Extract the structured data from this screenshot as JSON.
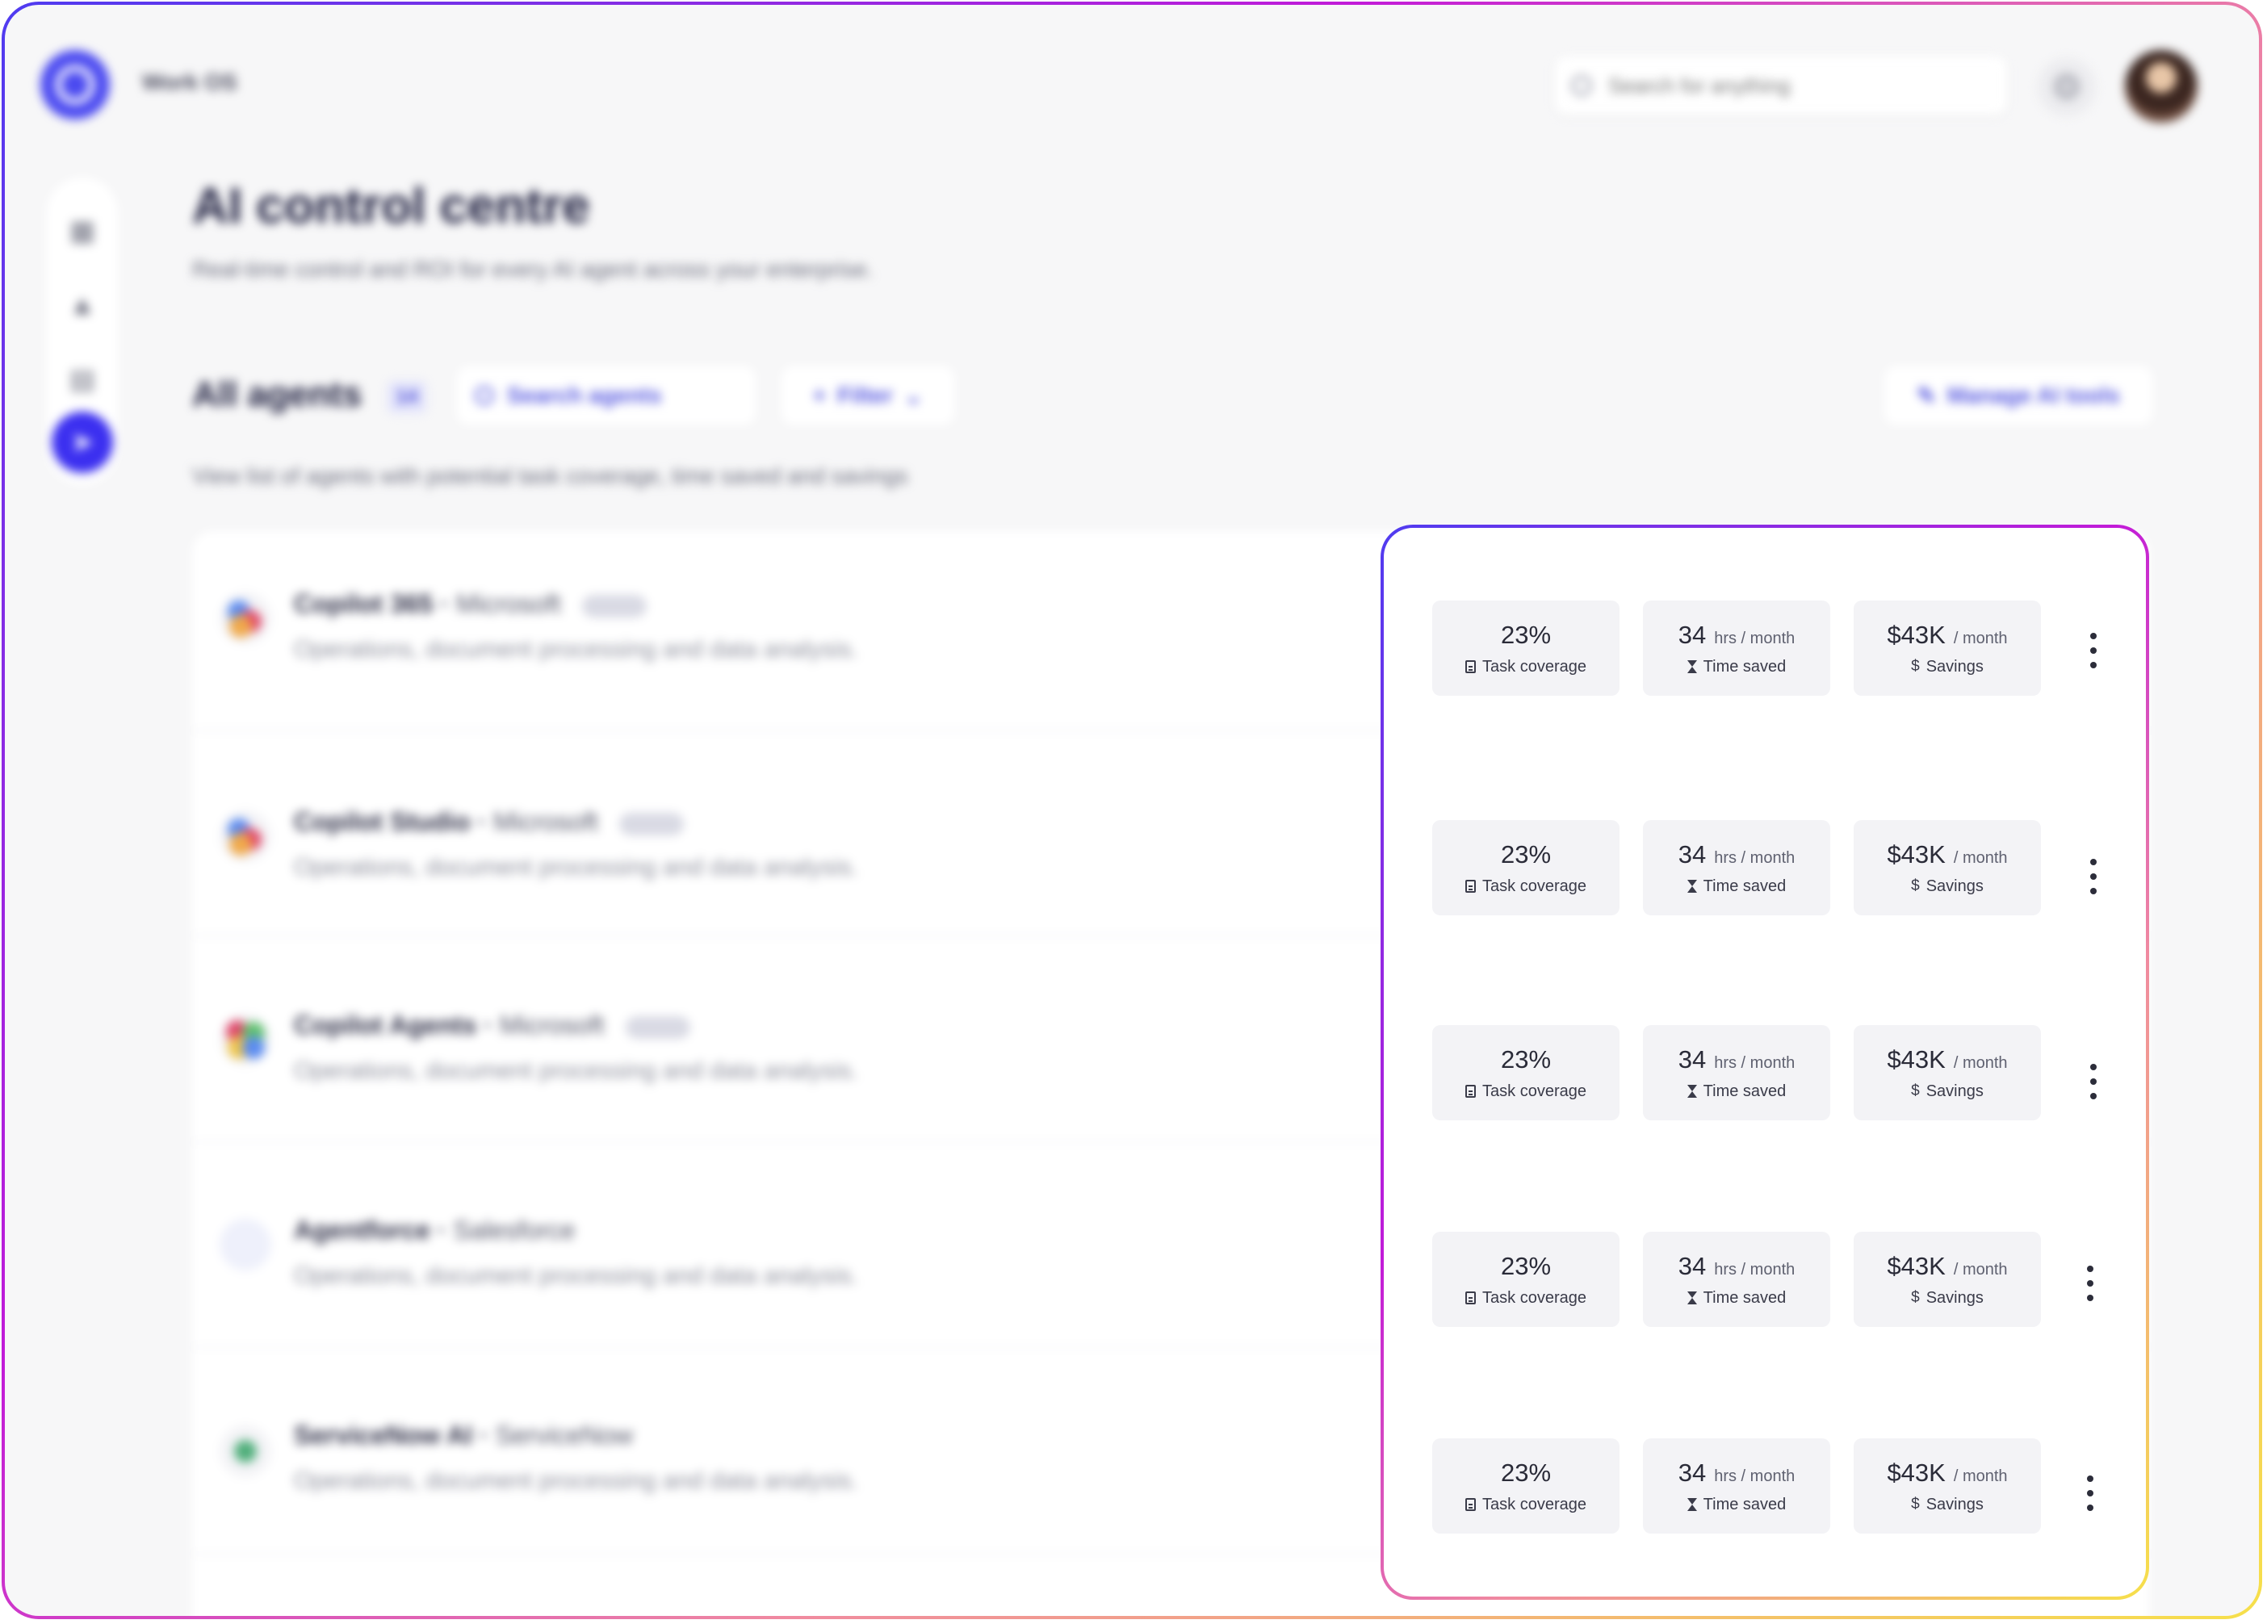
{
  "app": {
    "name": "Work OS"
  },
  "search": {
    "placeholder": "Search for anything"
  },
  "page": {
    "title": "AI control centre",
    "subtitle": "Real-time control and ROI for every AI agent across your enterprise."
  },
  "section": {
    "title": "All agents",
    "count": "14",
    "search_label": "Search agents",
    "filter_label": "Filter",
    "manage_label": "Manage AI tools",
    "subtitle": "View list of agents with potential task coverage, time saved and savings"
  },
  "agents": [
    {
      "name": "Copilot 365",
      "vendor": "Microsoft",
      "description": "Operations, document processing and data analysis.",
      "coverage": {
        "value": "23%",
        "label": "Task coverage"
      },
      "time": {
        "value": "34",
        "unit": "hrs / month",
        "label": "Time saved"
      },
      "savings": {
        "value": "$43K",
        "unit": "/ month",
        "label": "Savings",
        "glyph": "$"
      }
    },
    {
      "name": "Copilot Studio",
      "vendor": "Microsoft",
      "description": "Operations, document processing and data analysis.",
      "coverage": {
        "value": "23%",
        "label": "Task coverage"
      },
      "time": {
        "value": "34",
        "unit": "hrs / month",
        "label": "Time saved"
      },
      "savings": {
        "value": "$43K",
        "unit": "/ month",
        "label": "Savings",
        "glyph": "$"
      }
    },
    {
      "name": "Copilot Agents",
      "vendor": "Microsoft",
      "description": "Operations, document processing and data analysis.",
      "coverage": {
        "value": "23%",
        "label": "Task coverage"
      },
      "time": {
        "value": "34",
        "unit": "hrs / month",
        "label": "Time saved"
      },
      "savings": {
        "value": "$43K",
        "unit": "/ month",
        "label": "Savings",
        "glyph": "$"
      }
    },
    {
      "name": "Agentforce",
      "vendor": "Salesforce",
      "description": "Operations, document processing and data analysis.",
      "coverage": {
        "value": "23%",
        "label": "Task coverage"
      },
      "time": {
        "value": "34",
        "unit": "hrs / month",
        "label": "Time saved"
      },
      "savings": {
        "value": "$43K",
        "unit": "/ month",
        "label": "Savings",
        "glyph": "$"
      }
    },
    {
      "name": "ServiceNow AI",
      "vendor": "ServiceNow",
      "description": "Operations, document processing and data analysis.",
      "coverage": {
        "value": "23%",
        "label": "Task coverage"
      },
      "time": {
        "value": "34",
        "unit": "hrs / month",
        "label": "Time saved"
      },
      "savings": {
        "value": "$43K",
        "unit": "/ month",
        "label": "Savings",
        "glyph": "$"
      }
    }
  ],
  "icons": {
    "sidebar": [
      "grid-icon",
      "upload-icon",
      "document-icon",
      "send-icon"
    ],
    "metrics": [
      "document-icon",
      "hourglass-icon",
      "dollar-icon",
      "more-vertical-icon"
    ]
  },
  "colors": {
    "accent": "#3b2ff0",
    "gradient_start": "#4f3cf0",
    "gradient_mid": "#c21bd8",
    "gradient_end": "#f6e04a"
  }
}
